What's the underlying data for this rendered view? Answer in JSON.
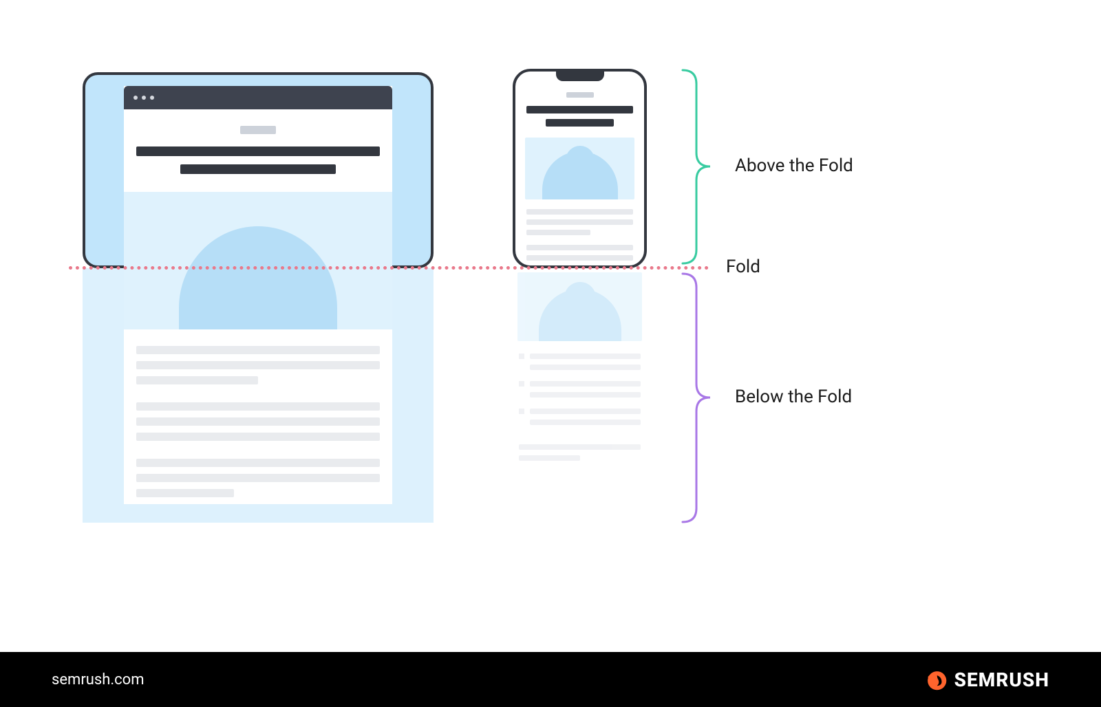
{
  "labels": {
    "above": "Above the Fold",
    "fold": "Fold",
    "below": "Below the Fold"
  },
  "footer": {
    "url": "semrush.com",
    "brand": "SEMRUSH"
  },
  "colors": {
    "above_bracket": "#38CBA0",
    "fold_line": "#E9798B",
    "below_bracket": "#A877E6",
    "device_frame": "#33373F",
    "screen_bg": "#C1E5FB",
    "hero_bg": "#DFF2FD",
    "hero_blob": "#B6DEF7",
    "text_bar": "#33373F",
    "subtle_bar": "#CDD2DA",
    "para_bar": "#E7E9ED",
    "brand_accent": "#FF642D"
  }
}
